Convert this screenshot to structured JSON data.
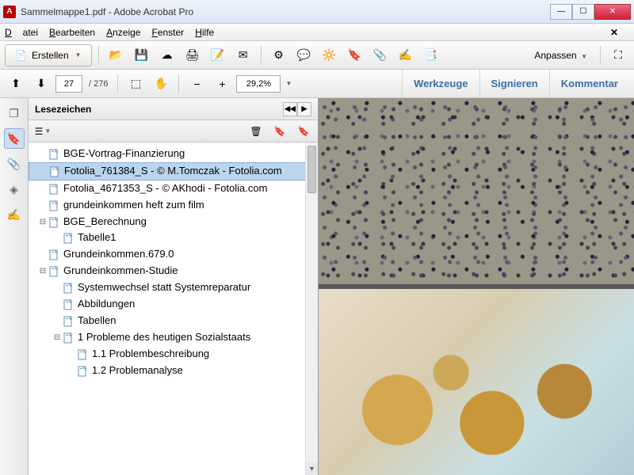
{
  "window": {
    "title": "Sammelmappe1.pdf - Adobe Acrobat Pro"
  },
  "menu": {
    "file": "Datei",
    "edit": "Bearbeiten",
    "view": "Anzeige",
    "window": "Fenster",
    "help": "Hilfe"
  },
  "toolbar": {
    "create": "Erstellen",
    "customize": "Anpassen"
  },
  "nav": {
    "page_current": "27",
    "page_total": "/ 276",
    "zoom": "29,2%"
  },
  "rightpanel": {
    "tools": "Werkzeuge",
    "sign": "Signieren",
    "comment": "Kommentar"
  },
  "bookmarks": {
    "title": "Lesezeichen",
    "items": [
      {
        "label": "BGE-Vortrag-Finanzierung",
        "level": 0,
        "exp": "",
        "sel": false
      },
      {
        "label": "Fotolia_761384_S - © M.Tomczak - Fotolia.com",
        "level": 0,
        "exp": "",
        "sel": true
      },
      {
        "label": "Fotolia_4671353_S - © AKhodi - Fotolia.com",
        "level": 0,
        "exp": "",
        "sel": false
      },
      {
        "label": "grundeinkommen heft zum film",
        "level": 0,
        "exp": "",
        "sel": false
      },
      {
        "label": "BGE_Berechnung",
        "level": 0,
        "exp": "⊟",
        "sel": false
      },
      {
        "label": "Tabelle1",
        "level": 1,
        "exp": "",
        "sel": false
      },
      {
        "label": "Grundeinkommen.679.0",
        "level": 0,
        "exp": "",
        "sel": false
      },
      {
        "label": "Grundeinkommen-Studie",
        "level": 0,
        "exp": "⊟",
        "sel": false
      },
      {
        "label": "Systemwechsel statt Systemreparatur",
        "level": 1,
        "exp": "",
        "sel": false
      },
      {
        "label": "Abbildungen",
        "level": 1,
        "exp": "",
        "sel": false
      },
      {
        "label": "Tabellen",
        "level": 1,
        "exp": "",
        "sel": false
      },
      {
        "label": "1  Probleme des heutigen Sozialstaats",
        "level": 1,
        "exp": "⊟",
        "sel": false
      },
      {
        "label": "1.1 Problembeschreibung",
        "level": 2,
        "exp": "",
        "sel": false
      },
      {
        "label": "1.2 Problemanalyse",
        "level": 2,
        "exp": "",
        "sel": false
      }
    ]
  }
}
